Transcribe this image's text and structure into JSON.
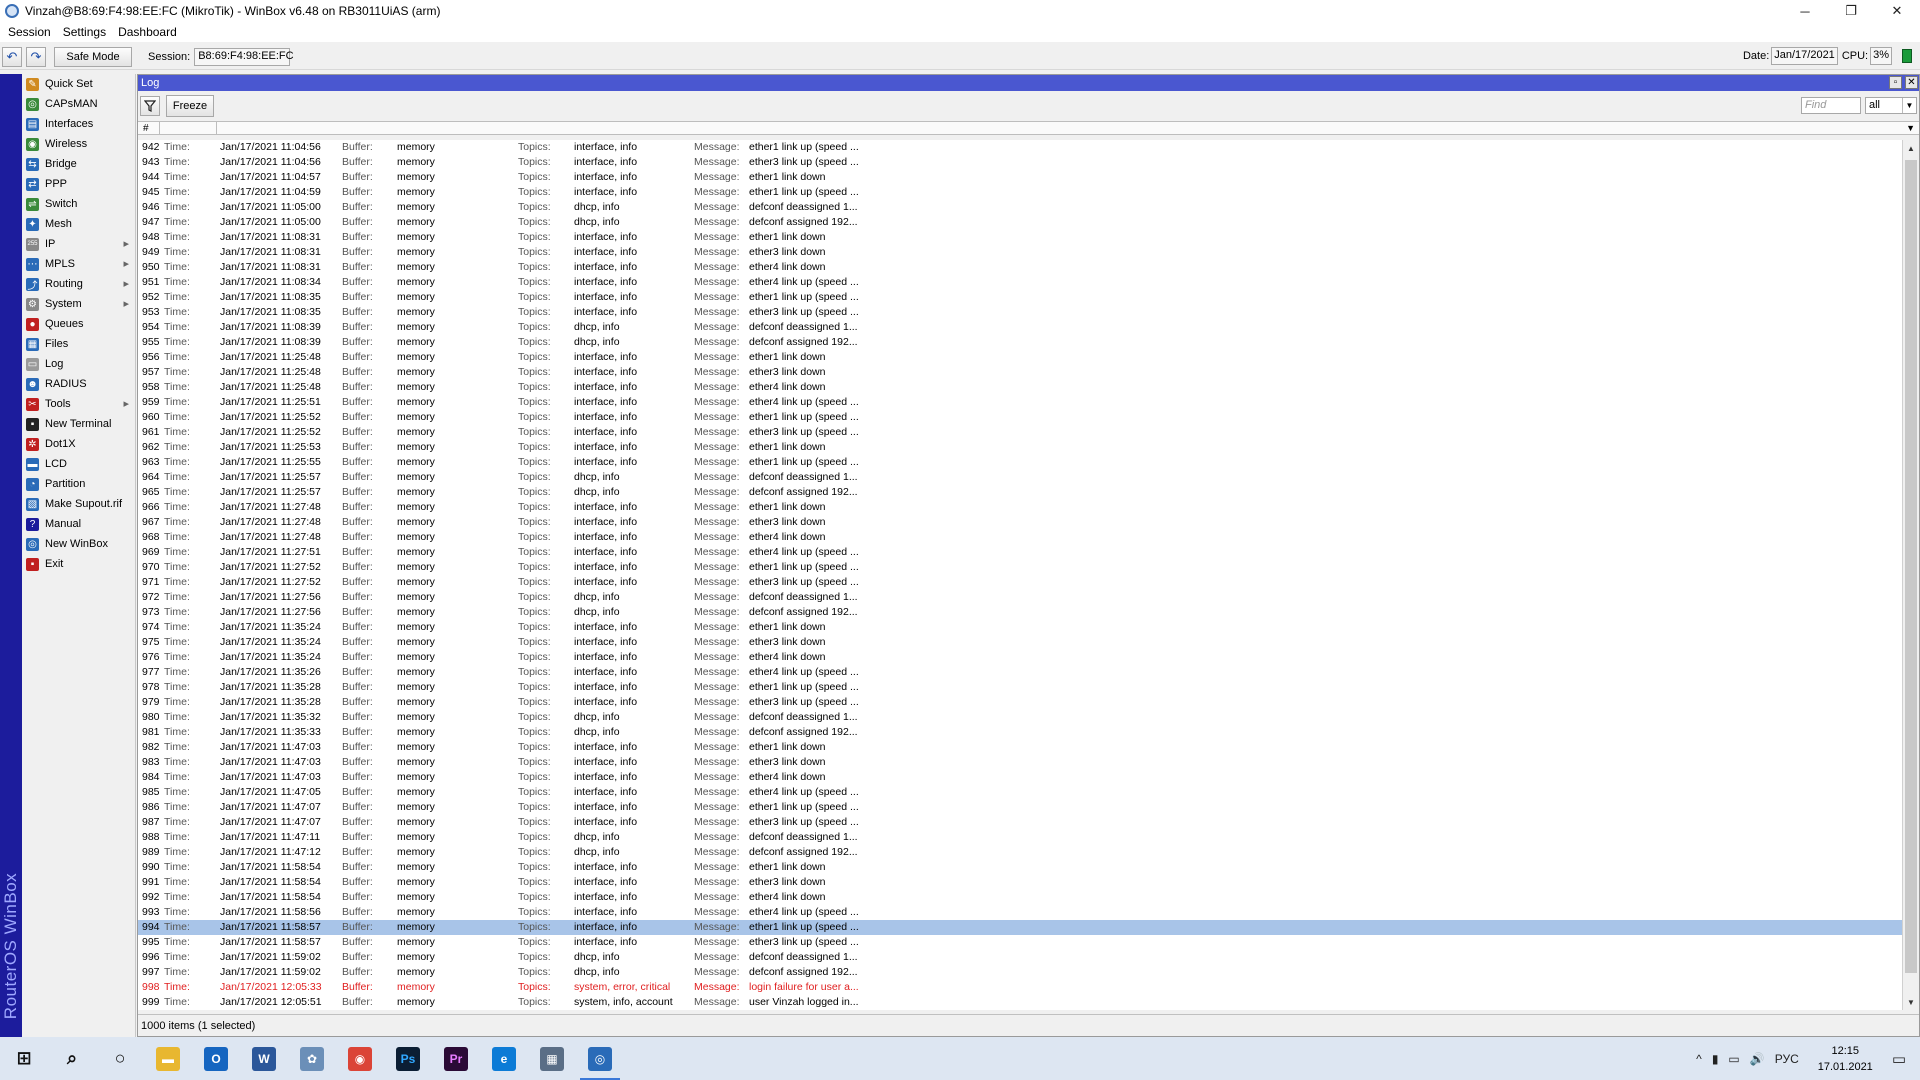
{
  "window": {
    "title": "Vinzah@B8:69:F4:98:EE:FC (MikroTik) - WinBox v6.48 on RB3011UiAS (arm)",
    "controls": [
      "─",
      "❐",
      "✕"
    ]
  },
  "menu": [
    "Session",
    "Settings",
    "Dashboard"
  ],
  "toolbar": {
    "undo": "↶",
    "redo": "↷",
    "safe_mode": "Safe Mode",
    "session_label": "Session:",
    "session_value": "B8:69:F4:98:EE:FC",
    "date_label": "Date:",
    "date_value": "Jan/17/2021",
    "cpu_label": "CPU:",
    "cpu_value": "3%"
  },
  "brand": "RouterOS WinBox",
  "sidebar": [
    {
      "label": "Quick Set",
      "icon": "wand-icon",
      "color": "#d08a20",
      "glyph": "✎"
    },
    {
      "label": "CAPsMAN",
      "icon": "capsman-icon",
      "color": "#3a8a3a",
      "glyph": "◎"
    },
    {
      "label": "Interfaces",
      "icon": "interfaces-icon",
      "color": "#2a6bb8",
      "glyph": "▤"
    },
    {
      "label": "Wireless",
      "icon": "wireless-icon",
      "color": "#3a8a3a",
      "glyph": "◉"
    },
    {
      "label": "Bridge",
      "icon": "bridge-icon",
      "color": "#2a6bb8",
      "glyph": "⇆"
    },
    {
      "label": "PPP",
      "icon": "ppp-icon",
      "color": "#2a6bb8",
      "glyph": "⇄"
    },
    {
      "label": "Switch",
      "icon": "switch-icon",
      "color": "#3a8a3a",
      "glyph": "⇌"
    },
    {
      "label": "Mesh",
      "icon": "mesh-icon",
      "color": "#2a6bb8",
      "glyph": "✦"
    },
    {
      "label": "IP",
      "icon": "ip-icon",
      "color": "#888888",
      "glyph": "255",
      "arrow": true
    },
    {
      "label": "MPLS",
      "icon": "mpls-icon",
      "color": "#2a6bb8",
      "glyph": "⋯",
      "arrow": true
    },
    {
      "label": "Routing",
      "icon": "routing-icon",
      "color": "#2a6bb8",
      "glyph": "⤴",
      "arrow": true
    },
    {
      "label": "System",
      "icon": "system-icon",
      "color": "#888888",
      "glyph": "⚙",
      "arrow": true
    },
    {
      "label": "Queues",
      "icon": "queues-icon",
      "color": "#c02020",
      "glyph": "●"
    },
    {
      "label": "Files",
      "icon": "files-icon",
      "color": "#2a6bb8",
      "glyph": "▦"
    },
    {
      "label": "Log",
      "icon": "log-icon",
      "color": "#9a9a9a",
      "glyph": "▭"
    },
    {
      "label": "RADIUS",
      "icon": "radius-icon",
      "color": "#2a6bb8",
      "glyph": "☻"
    },
    {
      "label": "Tools",
      "icon": "tools-icon",
      "color": "#c02020",
      "glyph": "✂",
      "arrow": true
    },
    {
      "label": "New Terminal",
      "icon": "terminal-icon",
      "color": "#222222",
      "glyph": "▪"
    },
    {
      "label": "Dot1X",
      "icon": "dot1x-icon",
      "color": "#c02020",
      "glyph": "✲"
    },
    {
      "label": "LCD",
      "icon": "lcd-icon",
      "color": "#2a6bb8",
      "glyph": "▬"
    },
    {
      "label": "Partition",
      "icon": "partition-icon",
      "color": "#2a6bb8",
      "glyph": "◔"
    },
    {
      "label": "Make Supout.rif",
      "icon": "supout-icon",
      "color": "#2a6bb8",
      "glyph": "▧"
    },
    {
      "label": "Manual",
      "icon": "manual-icon",
      "color": "#1c1c9c",
      "glyph": "?"
    },
    {
      "label": "New WinBox",
      "icon": "winbox-icon",
      "color": "#2a6bb8",
      "glyph": "◎"
    },
    {
      "label": "Exit",
      "icon": "exit-icon",
      "color": "#c02020",
      "glyph": "▪"
    }
  ],
  "log": {
    "title": "Log",
    "freeze": "Freeze",
    "find_placeholder": "Find",
    "filter_value": "all",
    "col_num": "#",
    "labels": {
      "time": "Time:",
      "buffer": "Buffer:",
      "topics": "Topics:",
      "message": "Message:"
    },
    "status": "1000 items (1 selected)",
    "selected_index": 994,
    "rows": [
      [
        942,
        "Jan/17/2021 11:04:56",
        "memory",
        "interface, info",
        "ether1 link up (speed ..."
      ],
      [
        943,
        "Jan/17/2021 11:04:56",
        "memory",
        "interface, info",
        "ether3 link up (speed ..."
      ],
      [
        944,
        "Jan/17/2021 11:04:57",
        "memory",
        "interface, info",
        "ether1 link down"
      ],
      [
        945,
        "Jan/17/2021 11:04:59",
        "memory",
        "interface, info",
        "ether1 link up (speed ..."
      ],
      [
        946,
        "Jan/17/2021 11:05:00",
        "memory",
        "dhcp, info",
        "defconf deassigned 1..."
      ],
      [
        947,
        "Jan/17/2021 11:05:00",
        "memory",
        "dhcp, info",
        "defconf assigned 192..."
      ],
      [
        948,
        "Jan/17/2021 11:08:31",
        "memory",
        "interface, info",
        "ether1 link down"
      ],
      [
        949,
        "Jan/17/2021 11:08:31",
        "memory",
        "interface, info",
        "ether3 link down"
      ],
      [
        950,
        "Jan/17/2021 11:08:31",
        "memory",
        "interface, info",
        "ether4 link down"
      ],
      [
        951,
        "Jan/17/2021 11:08:34",
        "memory",
        "interface, info",
        "ether4 link up (speed ..."
      ],
      [
        952,
        "Jan/17/2021 11:08:35",
        "memory",
        "interface, info",
        "ether1 link up (speed ..."
      ],
      [
        953,
        "Jan/17/2021 11:08:35",
        "memory",
        "interface, info",
        "ether3 link up (speed ..."
      ],
      [
        954,
        "Jan/17/2021 11:08:39",
        "memory",
        "dhcp, info",
        "defconf deassigned 1..."
      ],
      [
        955,
        "Jan/17/2021 11:08:39",
        "memory",
        "dhcp, info",
        "defconf assigned 192..."
      ],
      [
        956,
        "Jan/17/2021 11:25:48",
        "memory",
        "interface, info",
        "ether1 link down"
      ],
      [
        957,
        "Jan/17/2021 11:25:48",
        "memory",
        "interface, info",
        "ether3 link down"
      ],
      [
        958,
        "Jan/17/2021 11:25:48",
        "memory",
        "interface, info",
        "ether4 link down"
      ],
      [
        959,
        "Jan/17/2021 11:25:51",
        "memory",
        "interface, info",
        "ether4 link up (speed ..."
      ],
      [
        960,
        "Jan/17/2021 11:25:52",
        "memory",
        "interface, info",
        "ether1 link up (speed ..."
      ],
      [
        961,
        "Jan/17/2021 11:25:52",
        "memory",
        "interface, info",
        "ether3 link up (speed ..."
      ],
      [
        962,
        "Jan/17/2021 11:25:53",
        "memory",
        "interface, info",
        "ether1 link down"
      ],
      [
        963,
        "Jan/17/2021 11:25:55",
        "memory",
        "interface, info",
        "ether1 link up (speed ..."
      ],
      [
        964,
        "Jan/17/2021 11:25:57",
        "memory",
        "dhcp, info",
        "defconf deassigned 1..."
      ],
      [
        965,
        "Jan/17/2021 11:25:57",
        "memory",
        "dhcp, info",
        "defconf assigned 192..."
      ],
      [
        966,
        "Jan/17/2021 11:27:48",
        "memory",
        "interface, info",
        "ether1 link down"
      ],
      [
        967,
        "Jan/17/2021 11:27:48",
        "memory",
        "interface, info",
        "ether3 link down"
      ],
      [
        968,
        "Jan/17/2021 11:27:48",
        "memory",
        "interface, info",
        "ether4 link down"
      ],
      [
        969,
        "Jan/17/2021 11:27:51",
        "memory",
        "interface, info",
        "ether4 link up (speed ..."
      ],
      [
        970,
        "Jan/17/2021 11:27:52",
        "memory",
        "interface, info",
        "ether1 link up (speed ..."
      ],
      [
        971,
        "Jan/17/2021 11:27:52",
        "memory",
        "interface, info",
        "ether3 link up (speed ..."
      ],
      [
        972,
        "Jan/17/2021 11:27:56",
        "memory",
        "dhcp, info",
        "defconf deassigned 1..."
      ],
      [
        973,
        "Jan/17/2021 11:27:56",
        "memory",
        "dhcp, info",
        "defconf assigned 192..."
      ],
      [
        974,
        "Jan/17/2021 11:35:24",
        "memory",
        "interface, info",
        "ether1 link down"
      ],
      [
        975,
        "Jan/17/2021 11:35:24",
        "memory",
        "interface, info",
        "ether3 link down"
      ],
      [
        976,
        "Jan/17/2021 11:35:24",
        "memory",
        "interface, info",
        "ether4 link down"
      ],
      [
        977,
        "Jan/17/2021 11:35:26",
        "memory",
        "interface, info",
        "ether4 link up (speed ..."
      ],
      [
        978,
        "Jan/17/2021 11:35:28",
        "memory",
        "interface, info",
        "ether1 link up (speed ..."
      ],
      [
        979,
        "Jan/17/2021 11:35:28",
        "memory",
        "interface, info",
        "ether3 link up (speed ..."
      ],
      [
        980,
        "Jan/17/2021 11:35:32",
        "memory",
        "dhcp, info",
        "defconf deassigned 1..."
      ],
      [
        981,
        "Jan/17/2021 11:35:33",
        "memory",
        "dhcp, info",
        "defconf assigned 192..."
      ],
      [
        982,
        "Jan/17/2021 11:47:03",
        "memory",
        "interface, info",
        "ether1 link down"
      ],
      [
        983,
        "Jan/17/2021 11:47:03",
        "memory",
        "interface, info",
        "ether3 link down"
      ],
      [
        984,
        "Jan/17/2021 11:47:03",
        "memory",
        "interface, info",
        "ether4 link down"
      ],
      [
        985,
        "Jan/17/2021 11:47:05",
        "memory",
        "interface, info",
        "ether4 link up (speed ..."
      ],
      [
        986,
        "Jan/17/2021 11:47:07",
        "memory",
        "interface, info",
        "ether1 link up (speed ..."
      ],
      [
        987,
        "Jan/17/2021 11:47:07",
        "memory",
        "interface, info",
        "ether3 link up (speed ..."
      ],
      [
        988,
        "Jan/17/2021 11:47:11",
        "memory",
        "dhcp, info",
        "defconf deassigned 1..."
      ],
      [
        989,
        "Jan/17/2021 11:47:12",
        "memory",
        "dhcp, info",
        "defconf assigned 192..."
      ],
      [
        990,
        "Jan/17/2021 11:58:54",
        "memory",
        "interface, info",
        "ether1 link down"
      ],
      [
        991,
        "Jan/17/2021 11:58:54",
        "memory",
        "interface, info",
        "ether3 link down"
      ],
      [
        992,
        "Jan/17/2021 11:58:54",
        "memory",
        "interface, info",
        "ether4 link down"
      ],
      [
        993,
        "Jan/17/2021 11:58:56",
        "memory",
        "interface, info",
        "ether4 link up (speed ..."
      ],
      [
        994,
        "Jan/17/2021 11:58:57",
        "memory",
        "interface, info",
        "ether1 link up (speed ..."
      ],
      [
        995,
        "Jan/17/2021 11:58:57",
        "memory",
        "interface, info",
        "ether3 link up (speed ..."
      ],
      [
        996,
        "Jan/17/2021 11:59:02",
        "memory",
        "dhcp, info",
        "defconf deassigned 1..."
      ],
      [
        997,
        "Jan/17/2021 11:59:02",
        "memory",
        "dhcp, info",
        "defconf assigned 192..."
      ],
      [
        998,
        "Jan/17/2021 12:05:33",
        "memory",
        "system, error, critical",
        "login failure for user a...",
        "error"
      ],
      [
        999,
        "Jan/17/2021 12:05:51",
        "memory",
        "system, info, account",
        "user Vinzah logged in..."
      ]
    ]
  },
  "taskbar": {
    "apps": [
      {
        "name": "start-icon",
        "glyph": "⊞",
        "color": "transparent",
        "fg": "#111111"
      },
      {
        "name": "search-icon",
        "glyph": "⌕",
        "color": "transparent",
        "fg": "#111111"
      },
      {
        "name": "cortana-icon",
        "glyph": "○",
        "color": "transparent",
        "fg": "#111111"
      },
      {
        "name": "explorer-icon",
        "glyph": "▬",
        "color": "#e8b730",
        "fg": "#ffffff"
      },
      {
        "name": "outlook-icon",
        "glyph": "O",
        "color": "#1565c0",
        "fg": "#ffffff"
      },
      {
        "name": "word-icon",
        "glyph": "W",
        "color": "#2b579a",
        "fg": "#ffffff"
      },
      {
        "name": "settings-app-icon",
        "glyph": "✿",
        "color": "#6b8fb8",
        "fg": "#ffffff"
      },
      {
        "name": "chrome-icon",
        "glyph": "◉",
        "color": "#db4437",
        "fg": "#ffffff"
      },
      {
        "name": "photoshop-icon",
        "glyph": "Ps",
        "color": "#0b1e34",
        "fg": "#31a8ff"
      },
      {
        "name": "premiere-icon",
        "glyph": "Pr",
        "color": "#2a0a36",
        "fg": "#e77cff"
      },
      {
        "name": "edge-icon",
        "glyph": "e",
        "color": "#0c7bd6",
        "fg": "#ffffff"
      },
      {
        "name": "calculator-icon",
        "glyph": "▦",
        "color": "#5a6e86",
        "fg": "#ffffff"
      },
      {
        "name": "winbox-taskbar-icon",
        "glyph": "◎",
        "color": "#2a6bb8",
        "fg": "#ffffff",
        "active": true
      }
    ],
    "tray": [
      "^",
      "▮",
      "▭",
      "🔊",
      "РУС"
    ],
    "time": "12:15",
    "date": "17.01.2021"
  }
}
